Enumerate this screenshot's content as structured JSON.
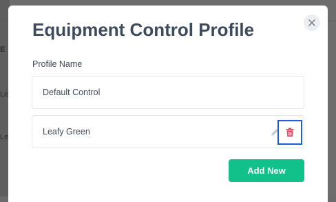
{
  "modal": {
    "title": "Equipment Control Profile",
    "field_label": "Profile Name",
    "profiles": [
      {
        "name": "Default Control"
      },
      {
        "name": "Leafy Green"
      }
    ],
    "add_button_label": "Add New"
  },
  "icons": {
    "close": "close-icon",
    "edit": "pencil-icon",
    "delete": "trash-icon"
  },
  "colors": {
    "primary_button": "#12c08a",
    "delete_icon": "#e8435a",
    "highlight_border": "#1e5bd8",
    "title_text": "#3d4b5c"
  }
}
